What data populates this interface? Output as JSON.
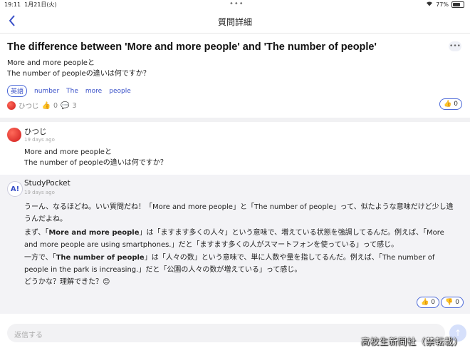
{
  "status": {
    "time": "19:11",
    "date": "1月21日(火)",
    "battery": "77%",
    "battery_level": 0.77
  },
  "nav": {
    "title": "質問詳細"
  },
  "question": {
    "title": "The difference between 'More and more people' and 'The number of people'",
    "body_line1": "More and more peopleと",
    "body_line2": "The number of peopleの違いは何ですか？",
    "tags": [
      "英語",
      "number",
      "The",
      "more",
      "people"
    ],
    "author": "ひつじ",
    "likes": "0",
    "comments": "3",
    "like_count": "0"
  },
  "posts": [
    {
      "author": "ひつじ",
      "date": "19 days ago",
      "line1": "More and more peopleと",
      "line2": "The number of peopleの違いは何ですか？"
    },
    {
      "author": "StudyPocket",
      "date": "19 days ago",
      "p1": "うーん、なるほどね。いい質問だね！「More and more people」と「The number of people」って、似たような意味だけど少し違うんだよね。",
      "p2_pre": "まず、「",
      "p2_bold": "More and more people",
      "p2_post": "」は「ますます多くの人々」という意味で、増えている状態を強調してるんだ。例えば、「More and more people are using smartphones.」だと「ますます多くの人がスマートフォンを使っている」って感じ。",
      "p3_pre": "一方で、「",
      "p3_bold": "The number of people",
      "p3_post": "」は「人々の数」という意味で、単に人数や量を指してるんだ。例えば、「The number of people in the park is increasing.」だと「公園の人々の数が増えている」って感じ。",
      "p4": "どうかな？理解できた？😊",
      "likes": "0",
      "dislikes": "0"
    }
  ],
  "reply": {
    "placeholder": "返信する"
  },
  "watermark": "高校生新聞社（禁転載）"
}
